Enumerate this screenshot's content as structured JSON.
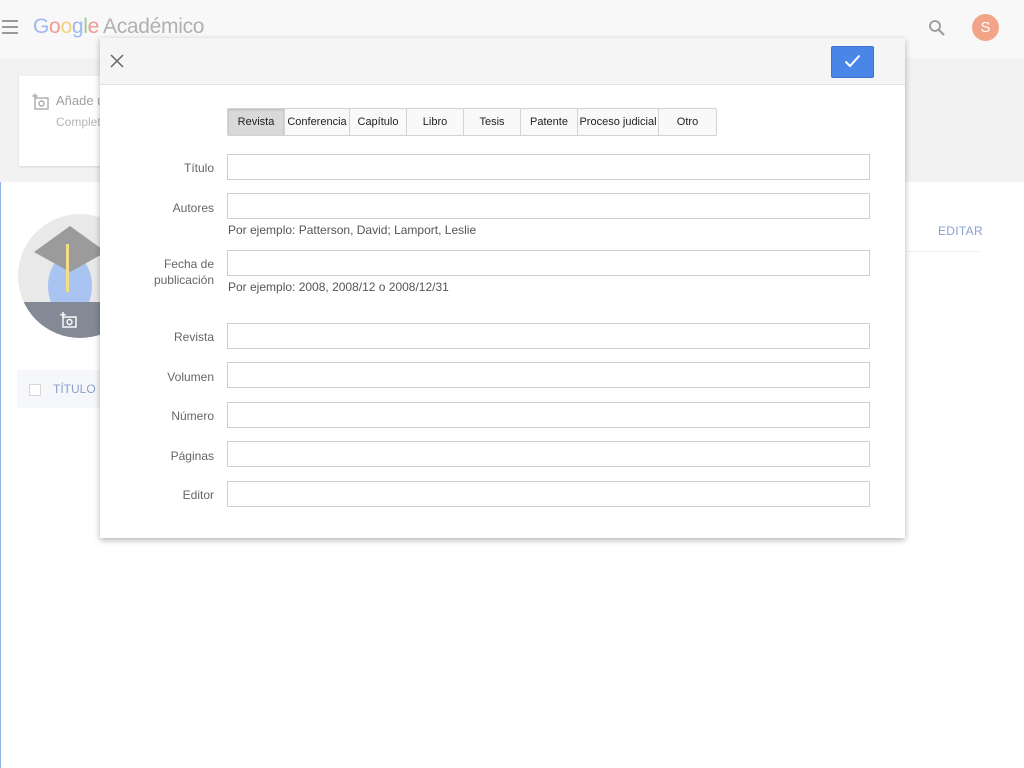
{
  "app": {
    "logo_letters": [
      "G",
      "o",
      "o",
      "g",
      "l",
      "e"
    ],
    "product": "Académico",
    "user_initial": "S"
  },
  "background": {
    "add_card_title": "Añade u",
    "add_card_subtitle": "Completa",
    "edit_label": "EDITAR",
    "title_column": "TÍTULO"
  },
  "modal": {
    "tabs": [
      {
        "label": "Revista",
        "active": true
      },
      {
        "label": "Conferencia",
        "active": false
      },
      {
        "label": "Capítulo",
        "active": false
      },
      {
        "label": "Libro",
        "active": false
      },
      {
        "label": "Tesis",
        "active": false
      },
      {
        "label": "Patente",
        "active": false
      },
      {
        "label": "Proceso judicial",
        "active": false
      },
      {
        "label": "Otro",
        "active": false
      }
    ],
    "fields": {
      "titulo": {
        "label": "Título",
        "value": ""
      },
      "autores": {
        "label": "Autores",
        "value": "",
        "hint": "Por ejemplo: Patterson, David; Lamport, Leslie"
      },
      "fecha": {
        "label_line1": "Fecha de",
        "label_line2": "publicación",
        "value": "",
        "hint": "Por ejemplo: 2008, 2008/12 o 2008/12/31"
      },
      "revista": {
        "label": "Revista",
        "value": ""
      },
      "volumen": {
        "label": "Volumen",
        "value": ""
      },
      "numero": {
        "label": "Número",
        "value": ""
      },
      "paginas": {
        "label": "Páginas",
        "value": ""
      },
      "editor": {
        "label": "Editor",
        "value": ""
      }
    }
  },
  "colors": {
    "accent": "#4a86e8",
    "link": "#8a9fd2",
    "avatar": "#f2a489"
  }
}
